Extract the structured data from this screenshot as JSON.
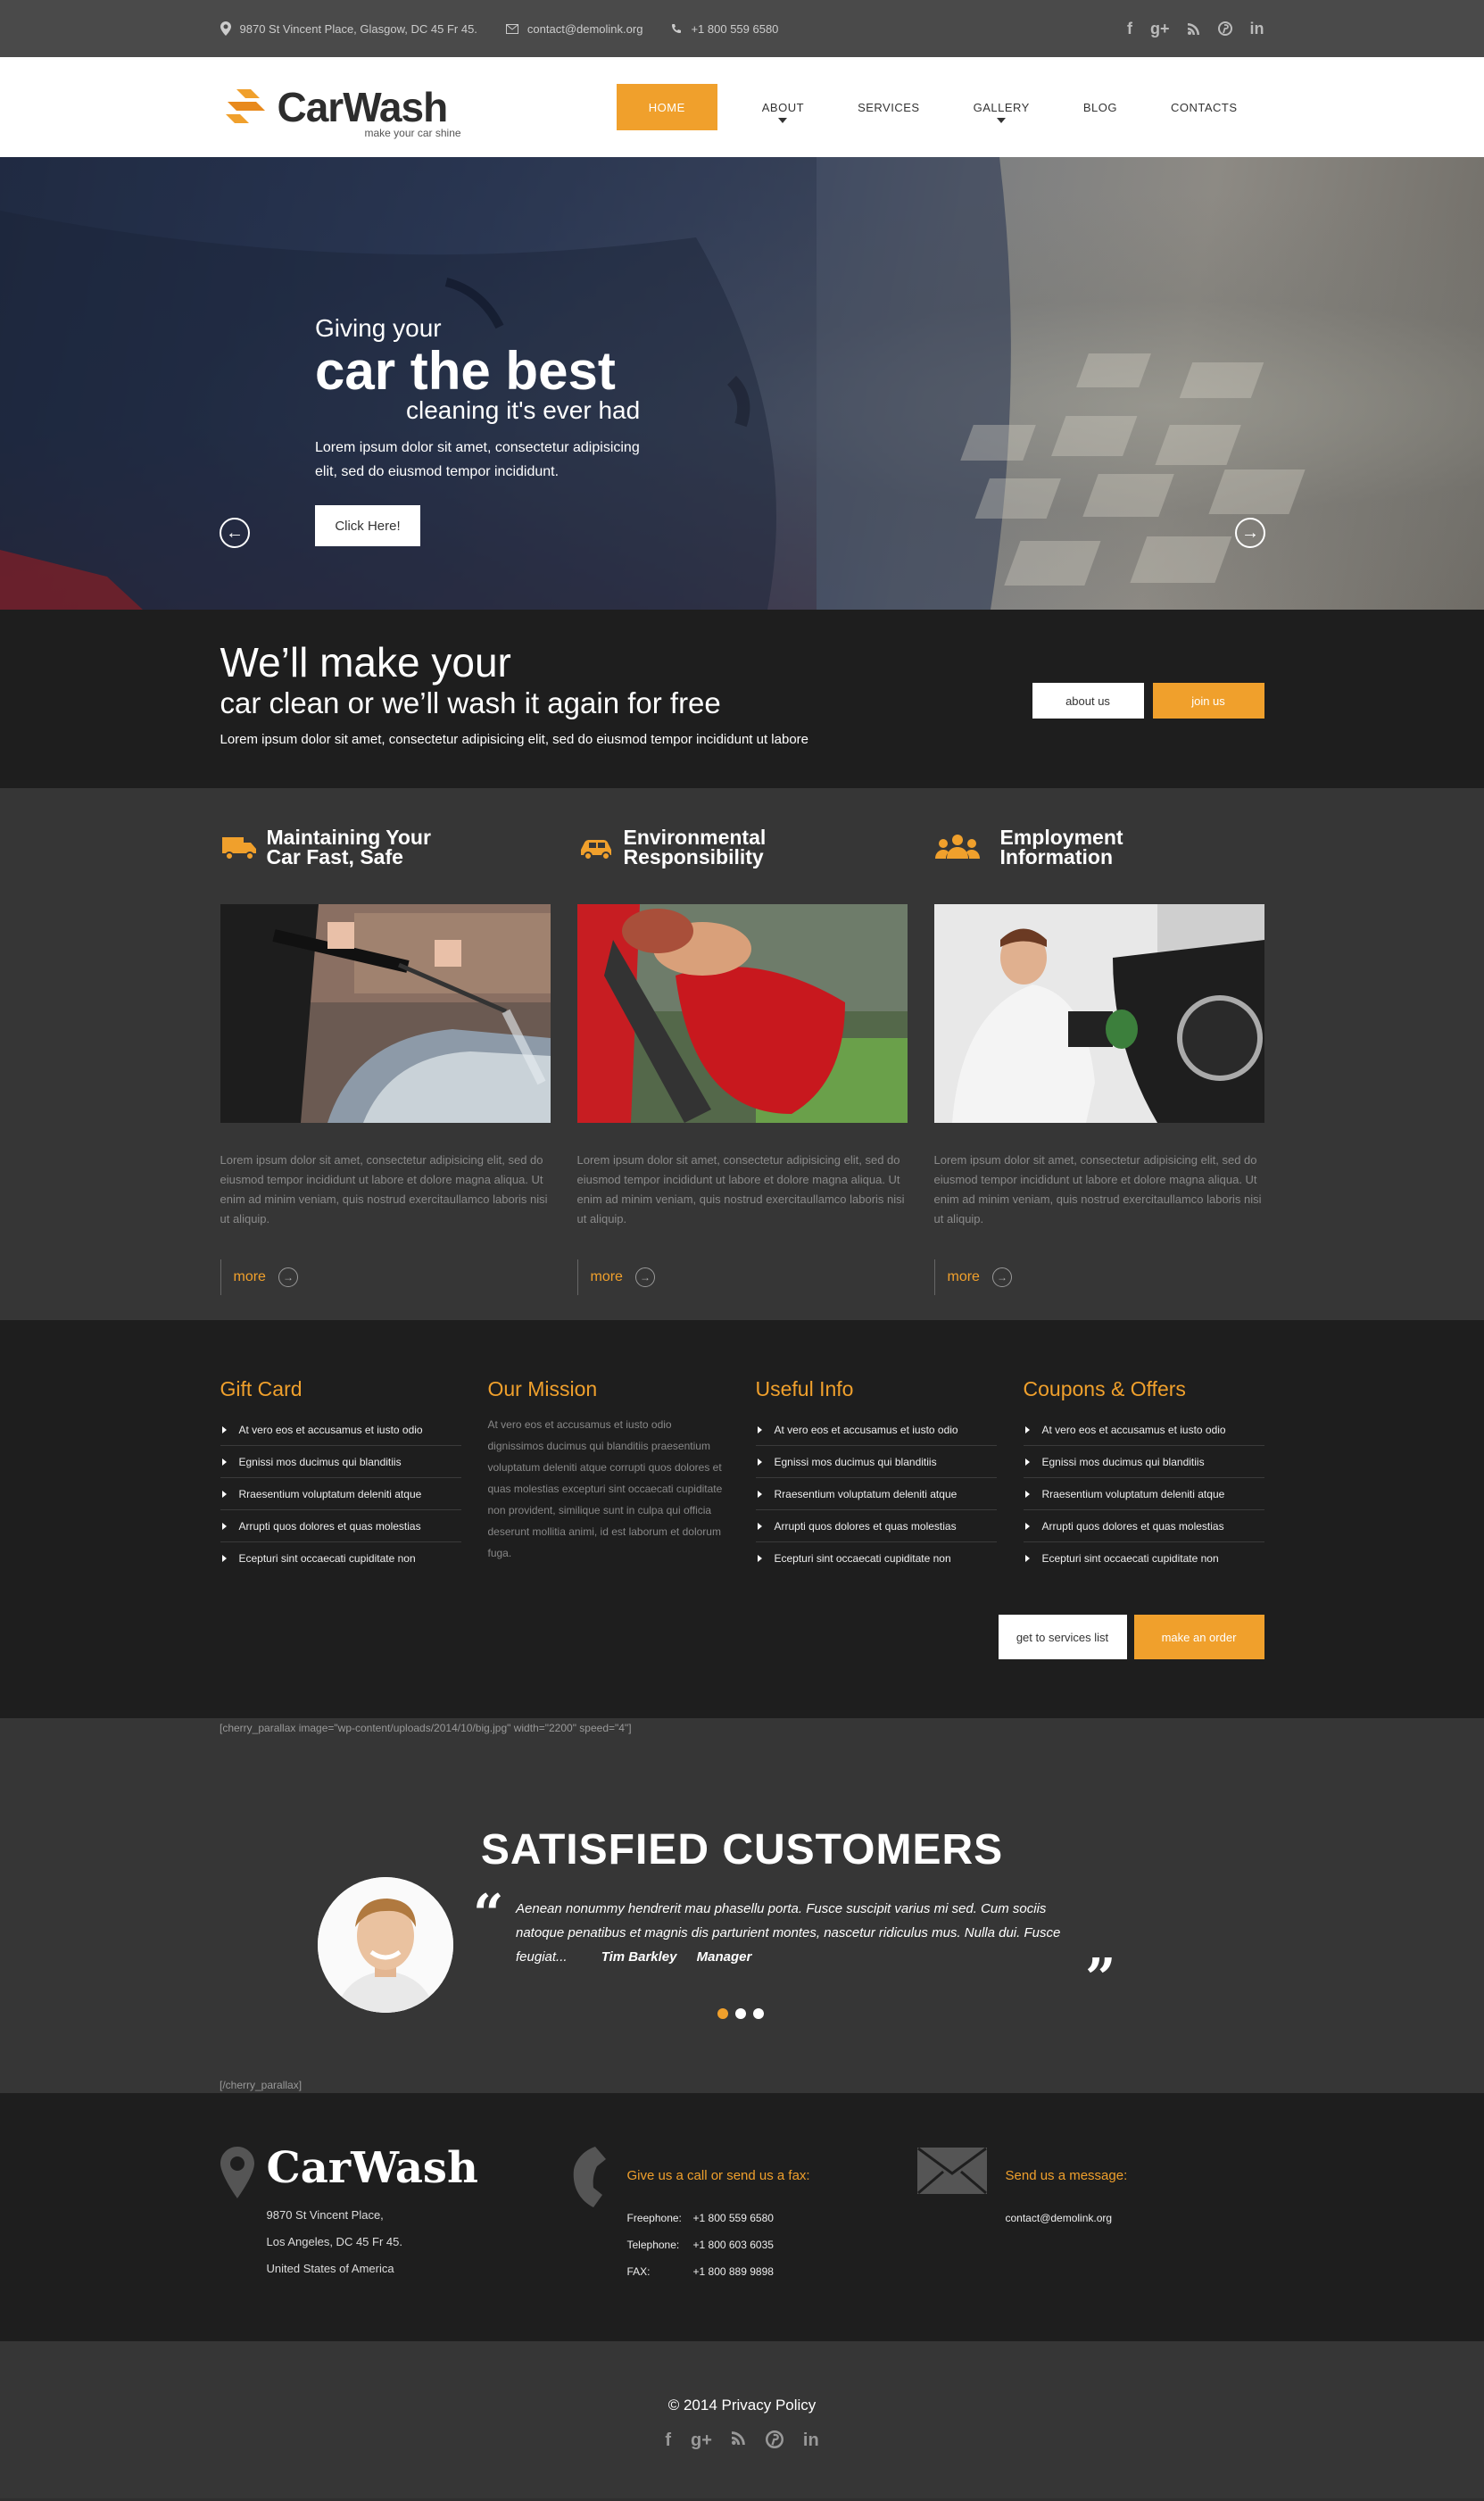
{
  "topbar": {
    "address": "9870 St Vincent Place, Glasgow, DC 45 Fr 45.",
    "email": "contact@demolink.org",
    "phone": "+1 800 559 6580",
    "social": [
      "f",
      "g+",
      "rss",
      "p",
      "in"
    ]
  },
  "header": {
    "logo": "CarWash",
    "tagline": "make your car shine",
    "nav": [
      "HOME",
      "ABOUT",
      "SERVICES",
      "GALLERY",
      "BLOG",
      "CONTACTS"
    ]
  },
  "hero": {
    "line1": "Giving your",
    "line2": "car the best",
    "line3": "cleaning it's ever had",
    "text": "Lorem ipsum dolor sit amet, consectetur adipisicing elit, sed do eiusmod tempor incididunt.",
    "button": "Click Here!",
    "prev": "←",
    "next": "→"
  },
  "promo": {
    "h1": "We’ll make your",
    "h2": "car clean or we’ll wash it again for free",
    "text": "Lorem ipsum dolor sit amet, consectetur adipisicing elit, sed do eiusmod tempor incididunt ut labore",
    "btn_about": "about us",
    "btn_join": "join us"
  },
  "features": [
    {
      "title1": "Maintaining Your",
      "title2": "Car Fast, Safe",
      "icon": "truck-icon",
      "text": "Lorem ipsum dolor sit amet, consectetur adipisicing elit, sed do eiusmod tempor incididunt ut labore et dolore magna aliqua. Ut enim ad minim veniam, quis nostrud exercitaullamco laboris nisi ut aliquip.",
      "more": "more"
    },
    {
      "title1": "Environmental",
      "title2": "Responsibility",
      "icon": "car-icon",
      "text": "Lorem ipsum dolor sit amet, consectetur adipisicing elit, sed do eiusmod tempor incididunt ut labore et dolore magna aliqua. Ut enim ad minim veniam, quis nostrud exercitaullamco laboris nisi ut aliquip.",
      "more": "more"
    },
    {
      "title1": "Employment",
      "title2": "Information",
      "icon": "people-icon",
      "text": "Lorem ipsum dolor sit amet, consectetur adipisicing elit, sed do eiusmod tempor incididunt ut labore et dolore magna aliqua. Ut enim ad minim veniam, quis nostrud exercitaullamco laboris nisi ut aliquip.",
      "more": "more"
    }
  ],
  "info": {
    "gift": {
      "title": "Gift Card",
      "items": [
        "At vero eos et accusamus et iusto odio",
        "Egnissi mos ducimus qui blanditiis",
        "Rraesentium voluptatum deleniti atque",
        "Arrupti quos dolores et quas molestias",
        "Ecepturi sint occaecati cupiditate non"
      ]
    },
    "mission": {
      "title": "Our Mission",
      "text": "At vero eos et accusamus et iusto odio dignissimos ducimus qui blanditiis praesentium voluptatum deleniti atque corrupti quos dolores et quas molestias excepturi sint occaecati cupiditate non provident, similique sunt in culpa qui officia deserunt mollitia animi, id est laborum et dolorum fuga."
    },
    "useful": {
      "title": "Useful Info",
      "items": [
        "At vero eos et accusamus et iusto odio",
        "Egnissi mos ducimus qui blanditiis",
        "Rraesentium voluptatum deleniti atque",
        "Arrupti quos dolores et quas molestias",
        "Ecepturi sint occaecati cupiditate non"
      ]
    },
    "coupons": {
      "title": "Coupons & Offers",
      "items": [
        "At vero eos et accusamus et iusto odio",
        "Egnissi mos ducimus qui blanditiis",
        "Rraesentium voluptatum deleniti atque",
        "Arrupti quos dolores et quas molestias",
        "Ecepturi sint occaecati cupiditate non"
      ]
    },
    "btn_services": "get to services list",
    "btn_order": "make an order"
  },
  "testimonials": {
    "shortcode_open": "[cherry_parallax image=\"wp-content/uploads/2014/10/big.jpg\" width=\"2200\" speed=\"4\"]",
    "title": "SATISFIED CUSTOMERS",
    "quote": "Aenean nonummy hendrerit mau phasellu porta. Fusce suscipit varius mi sed. Cum sociis natoque penatibus et magnis dis parturient montes, nascetur ridiculus mus. Nulla dui. Fusce feugiat...",
    "author": "Tim Barkley",
    "role": "Manager",
    "shortcode_close": "[/cherry_parallax]",
    "open_quote": "“",
    "close_quote": "”"
  },
  "contact": {
    "brand": "CarWash",
    "address": [
      "9870 St Vincent Place,",
      "Los Angeles, DC 45 Fr 45.",
      "United States of America"
    ],
    "phone_heading": "Give us a call or send us a fax:",
    "phones": [
      {
        "label": "Freephone:",
        "value": "+1 800 559 6580"
      },
      {
        "label": "Telephone:",
        "value": "+1 800 603 6035"
      },
      {
        "label": "FAX:",
        "value": "+1 800 889 9898"
      }
    ],
    "msg_heading": "Send us a message:",
    "email": "contact@demolink.org"
  },
  "footer": {
    "copyright": "© 2014 Privacy Policy",
    "social": [
      "f",
      "g+",
      "rss",
      "p",
      "in"
    ]
  },
  "colors": {
    "accent": "#f0a02c",
    "dark": "#1e1e1e",
    "mid": "#363636"
  }
}
